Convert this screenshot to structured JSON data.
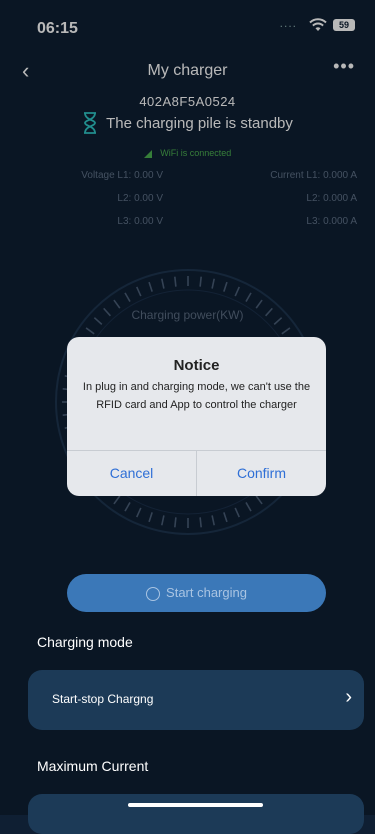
{
  "status_bar": {
    "time": "06:15",
    "signal": "....",
    "battery": "59"
  },
  "nav": {
    "back": "‹",
    "title": "My charger",
    "more": "•••"
  },
  "charger": {
    "serial": "402A8F5A0524",
    "state": "The charging pile is standby",
    "wifi": "WiFi is connected"
  },
  "metrics": {
    "voltage": [
      "Voltage L1: 0.00 V",
      "L2: 0.00 V",
      "L3: 0.00 V"
    ],
    "current": [
      "Current L1: 0.000 A",
      "L2: 0.000 A",
      "L3: 0.000 A"
    ]
  },
  "gauge": {
    "label": "Charging power(KW)"
  },
  "dialog": {
    "title": "Notice",
    "message": "In plug in and charging mode, we can't use the RFID card and App to control the charger",
    "cancel": "Cancel",
    "confirm": "Confirm"
  },
  "start_button": {
    "label": "Start charging"
  },
  "charging_mode": {
    "heading": "Charging mode",
    "value": "Start-stop Chargng"
  },
  "max_current": {
    "heading": "Maximum Current"
  },
  "colors": {
    "background": "#0f1f33",
    "accent": "#3b78b8",
    "dialog_button": "#2f6fd6",
    "wifi_ok": "#4caf50"
  }
}
